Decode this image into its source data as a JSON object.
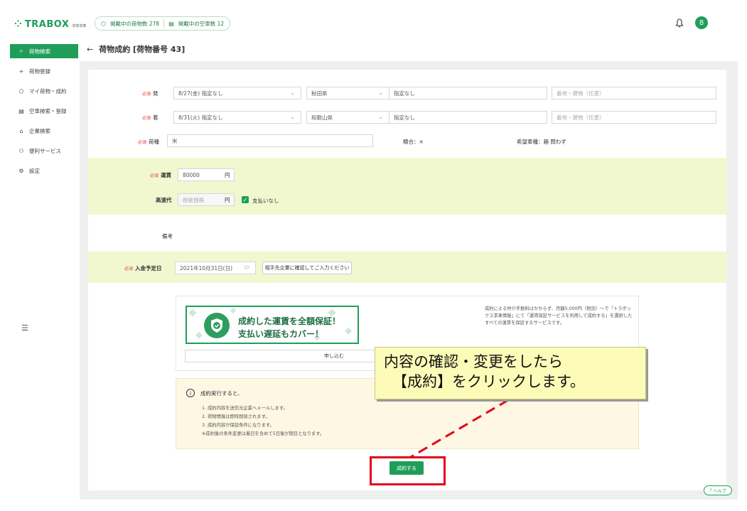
{
  "header": {
    "logo_text": "TRABOX",
    "logo_sub": "求荷求車",
    "stat_cargo": "掲載中の荷物数 278",
    "stat_vehicle": "掲載中の空車数 12",
    "avatar_initial": "8"
  },
  "sidebar": {
    "items": [
      {
        "label": "荷物検索",
        "icon": "search-icon"
      },
      {
        "label": "荷物登録",
        "icon": "plus-icon"
      },
      {
        "label": "マイ荷物・成約",
        "icon": "box-icon"
      },
      {
        "label": "空車検索・登録",
        "icon": "truck-icon"
      },
      {
        "label": "企業検索",
        "icon": "building-icon"
      },
      {
        "label": "便利サービス",
        "icon": "people-icon"
      },
      {
        "label": "設定",
        "icon": "gear-icon"
      }
    ]
  },
  "page": {
    "back_arrow": "←",
    "title": "荷物成約 [荷物番号 43]"
  },
  "form": {
    "required_tag": "必須",
    "departure": {
      "label": "発",
      "date": "8/27(金) 指定なし",
      "pref": "秋田県",
      "city": "指定なし",
      "address_placeholder": "番地・建物（任意）"
    },
    "arrival": {
      "label": "着",
      "date": "8/31(火) 指定なし",
      "pref": "和歌山県",
      "city": "指定なし",
      "address_placeholder": "番地・建物（任意）"
    },
    "cargo": {
      "label": "荷種",
      "value": "米",
      "mixed": "積合：×",
      "vehicle_type": "希望車種：箱 問わず"
    },
    "fare": {
      "label": "運賃",
      "value": "80000",
      "unit": "円"
    },
    "highway": {
      "label": "高速代",
      "placeholder": "税抜価格",
      "unit": "円",
      "no_pay_label": "支払いなし",
      "no_pay_checked": "✓"
    },
    "remarks": {
      "label": "備考"
    },
    "payment_date": {
      "label": "入金予定日",
      "value": "2021年10月31日(日)",
      "confirm_button": "相手先企業に確認してご入力ください"
    }
  },
  "guarantee": {
    "banner_line1": "成約した運賃を全額保証！",
    "banner_line2": "支払い遅延もカバー！",
    "description": "成約による仲介手数料はかからず、月額5,000円（税別）〜で「トラボックス求車情報」にて「運賃保証サービスを利用して成約する」を選択したすべての運賃を保証するサービスです。",
    "apply_button": "申し込む"
  },
  "notice": {
    "title": "成約実行すると、",
    "items": [
      "1. 成約内容を送信元企業へメールします。",
      "2. 荷物情報は即時削除されます。",
      "3. 成約内容が保証条件になります。",
      "※成約後の条件変更は着日を含めて5日後が期日となります。"
    ]
  },
  "submit_button": "成約する",
  "callout": {
    "line1": "内容の確認・変更をしたら",
    "line2": "【成約】をクリックします。"
  },
  "help_button": "ヘルプ",
  "colors": {
    "brand": "#1f9e5a",
    "band": "#f1f8cf",
    "highlight": "#e3001b",
    "callout_bg": "#fdfbb8"
  }
}
